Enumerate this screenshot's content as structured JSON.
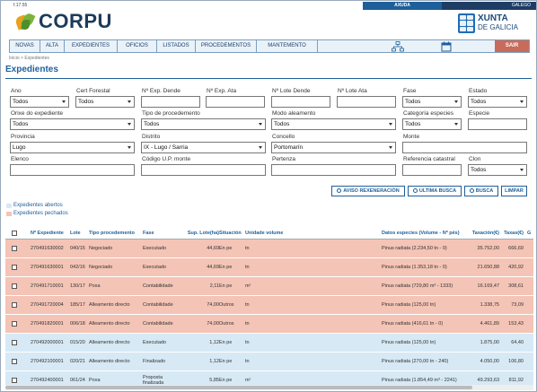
{
  "header": {
    "version": "f.17.55",
    "logo_text": "CORPU",
    "topbar_left": "AXUDA",
    "topbar_right": "GALEGO",
    "xunta_line1": "XUNTA",
    "xunta_line2": "DE GALICIA"
  },
  "nav": {
    "items": [
      "NOVAS",
      "ALTA",
      "EXPEDIENTES",
      "OFICIOS",
      "LISTADOS",
      "PROCEDEMENTOS",
      "MANTEMENTO"
    ],
    "logout": "SAIR"
  },
  "breadcrumb": "Inicio > Expedientes",
  "page_title": "Expedientes",
  "filters": {
    "ano": {
      "label": "Ano",
      "value": "Todos"
    },
    "cert_forestal": {
      "label": "Cert Forestal",
      "value": "Todos"
    },
    "exp_dende": {
      "label": "Nº Exp. Dende",
      "value": ""
    },
    "exp_ata": {
      "label": "Nº Exp. Ata",
      "value": ""
    },
    "lote_dende": {
      "label": "Nº Lote Dende",
      "value": ""
    },
    "lote_ata": {
      "label": "Nº Lote Ata",
      "value": ""
    },
    "fase": {
      "label": "Fase",
      "value": "Todos"
    },
    "estado": {
      "label": "Estado",
      "value": "Todos"
    },
    "orixe": {
      "label": "Orixe do expediente",
      "value": "Todos"
    },
    "tipo_procedemento": {
      "label": "Tipo de procedemento",
      "value": "Todos"
    },
    "modo_aleamento": {
      "label": "Modo aleamento",
      "value": "Todos"
    },
    "categoria_especies": {
      "label": "Categoría especies",
      "value": "Todos"
    },
    "especie": {
      "label": "Especie",
      "value": ""
    },
    "provincia": {
      "label": "Provincia",
      "value": "Lugo"
    },
    "distrito": {
      "label": "Distrito",
      "value": "IX - Lugo / Sarria"
    },
    "concello": {
      "label": "Concello",
      "value": "Portomarín"
    },
    "monte": {
      "label": "Monte",
      "value": ""
    },
    "elenco": {
      "label": "Elenco",
      "value": ""
    },
    "codigo_monte": {
      "label": "Código U.P. monte",
      "value": ""
    },
    "pertenza": {
      "label": "Pertenza",
      "value": ""
    },
    "ref_catastral": {
      "label": "Referencia catastral",
      "value": ""
    },
    "clon": {
      "label": "Clon",
      "value": "Todos"
    }
  },
  "buttons": {
    "avisos": "AVISO REXENERACIÓN",
    "ultima": "ULTIMA BUSCA",
    "busca": "BUSCA",
    "limpar": "LIMPAR"
  },
  "legend": {
    "open": "Expedientes abertos",
    "closed": "Expedientes pechados",
    "open_color": "#d6e9f5",
    "closed_color": "#f4c4b6"
  },
  "table": {
    "headers": [
      "Nº Expediente",
      "Lote",
      "Tipo procedemento",
      "Fase",
      "Sup. Lote(ha)",
      "Situación",
      "Unidade volume",
      "Datos especies (Volume - Nº pés)",
      "Taxación(€)",
      "Taxas(€)",
      "G"
    ],
    "rows": [
      {
        "status": "closed",
        "exp": "270491630002",
        "lote": "040/15",
        "tipo": "Negociado",
        "fase": "Executado",
        "sup": "44,69",
        "sit": "En pe",
        "uv": "tn",
        "datos": "Pinus radiata (2.234,50 tn - 0)",
        "tax": "35.752,00",
        "taxas": "666,69"
      },
      {
        "status": "closed",
        "exp": "270491630001",
        "lote": "042/16",
        "tipo": "Negociado",
        "fase": "Executado",
        "sup": "44,69",
        "sit": "En pe",
        "uv": "tn",
        "datos": "Pinus radiata (1.353,18 tn - 0)",
        "tax": "21.650,88",
        "taxas": "420,92"
      },
      {
        "status": "closed",
        "exp": "270491710001",
        "lote": "130/17",
        "tipo": "Poxa",
        "fase": "Contabilidade",
        "sup": "2,11",
        "sit": "En pe",
        "uv": "m³",
        "datos": "Pinus radiata (729,80 m³ - 1333)",
        "tax": "16.169,47",
        "taxas": "308,61"
      },
      {
        "status": "closed",
        "exp": "270491720004",
        "lote": "185/17",
        "tipo": "Alleamento directo",
        "fase": "Contabilidade",
        "sup": "74,00",
        "sit": "Outros",
        "uv": "tn",
        "datos": "Pinus radiata (125,00 tn)",
        "tax": "1.338,75",
        "taxas": "73,09"
      },
      {
        "status": "closed",
        "exp": "270491820001",
        "lote": "006/18",
        "tipo": "Alleamento directo",
        "fase": "Contabilidade",
        "sup": "74,00",
        "sit": "Outros",
        "uv": "tn",
        "datos": "Pinus radiata (416,61 tn - 0)",
        "tax": "4.461,89",
        "taxas": "153,43"
      },
      {
        "status": "open",
        "exp": "270492000001",
        "lote": "015/20",
        "tipo": "Alleamento directo",
        "fase": "Executado",
        "sup": "1,12",
        "sit": "En pe",
        "uv": "tn",
        "datos": "Pinus radiata (125,00 tn)",
        "tax": "1.875,00",
        "taxas": "64,40"
      },
      {
        "status": "open",
        "exp": "270492100001",
        "lote": "020/21",
        "tipo": "Alleamento directo",
        "fase": "Finalizado",
        "sup": "1,12",
        "sit": "En pe",
        "uv": "tn",
        "datos": "Pinus radiata (270,00 tn - 240)",
        "tax": "4.050,00",
        "taxas": "106,80"
      },
      {
        "status": "open",
        "exp": "270492400001",
        "lote": "061/24",
        "tipo": "Poxa",
        "fase": "Proposta finalizada",
        "sup": "5,85",
        "sit": "En pe",
        "uv": "m³",
        "datos": "Pinus radiata (1.854,49 m³ - 2241)",
        "tax": "49.293,63",
        "taxas": "811,92"
      }
    ]
  }
}
